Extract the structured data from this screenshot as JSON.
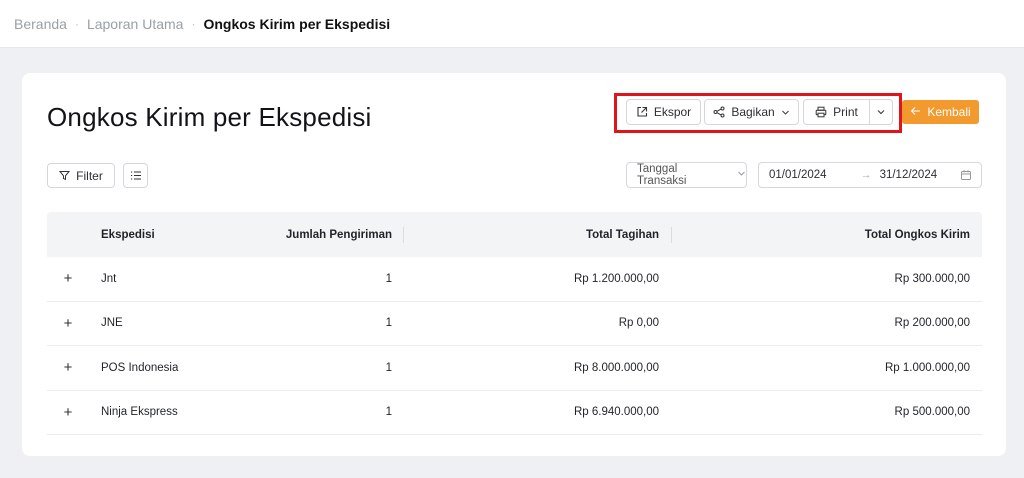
{
  "breadcrumb": {
    "items": [
      "Beranda",
      "Laporan Utama"
    ],
    "separator": "·",
    "current": "Ongkos Kirim per Ekspedisi"
  },
  "page": {
    "title": "Ongkos Kirim per Ekspedisi"
  },
  "toolbar": {
    "export_label": "Ekspor",
    "share_label": "Bagikan",
    "print_label": "Print",
    "back_label": "Kembali",
    "accent_color": "#f29a2e",
    "highlight_color": "#e0151b"
  },
  "filters": {
    "filter_label": "Filter",
    "date_type": "Tanggal Transaksi",
    "date_start": "01/01/2024",
    "date_end": "31/12/2024",
    "range_arrow": "→"
  },
  "table": {
    "headers": {
      "ekspedisi": "Ekspedisi",
      "jumlah": "Jumlah Pengiriman",
      "tagihan": "Total Tagihan",
      "ongkos": "Total Ongkos Kirim"
    },
    "expand_symbol": "+",
    "rows": [
      {
        "ekspedisi": "Jnt",
        "jumlah": "1",
        "tagihan": "Rp 1.200.000,00",
        "ongkos": "Rp 300.000,00"
      },
      {
        "ekspedisi": "JNE",
        "jumlah": "1",
        "tagihan": "Rp 0,00",
        "ongkos": "Rp 200.000,00"
      },
      {
        "ekspedisi": "POS Indonesia",
        "jumlah": "1",
        "tagihan": "Rp 8.000.000,00",
        "ongkos": "Rp 1.000.000,00"
      },
      {
        "ekspedisi": "Ninja Ekspress",
        "jumlah": "1",
        "tagihan": "Rp 6.940.000,00",
        "ongkos": "Rp 500.000,00"
      }
    ]
  }
}
